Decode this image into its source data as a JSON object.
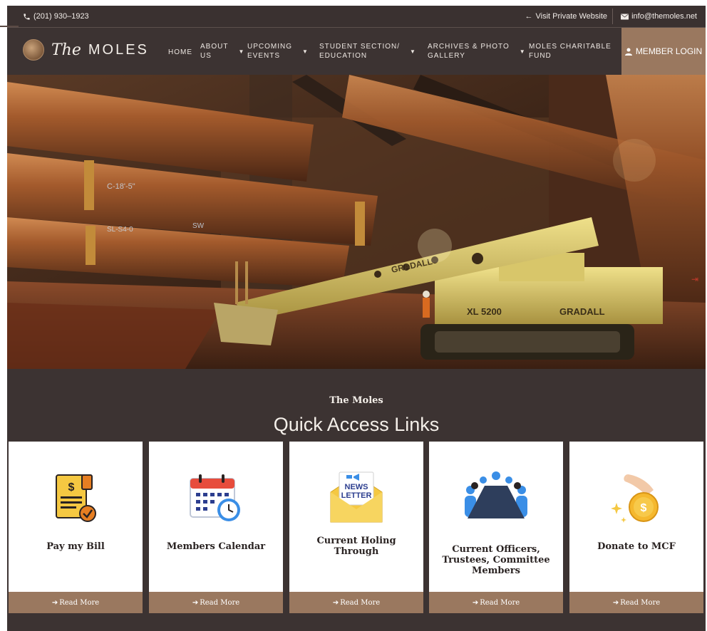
{
  "topbar": {
    "phone": "(201) 930–1923",
    "visit_link": "Visit Private Website",
    "email": "info@themoles.net"
  },
  "logo": {
    "the": "The",
    "moles": "MOLES"
  },
  "nav": {
    "items": [
      {
        "line1": "HOME",
        "line2": "",
        "has_dropdown": false
      },
      {
        "line1": "ABOUT",
        "line2": "US",
        "has_dropdown": true
      },
      {
        "line1": "UPCOMING",
        "line2": "EVENTS",
        "has_dropdown": true
      },
      {
        "line1": "STUDENT SECTION/",
        "line2": "EDUCATION",
        "has_dropdown": true
      },
      {
        "line1": "ARCHIVES & PHOTO",
        "line2": "GALLERY",
        "has_dropdown": true
      },
      {
        "line1": "MOLES CHARITABLE",
        "line2": "FUND",
        "has_dropdown": true
      }
    ],
    "login_label": "MEMBER LOGIN"
  },
  "hero": {
    "crane_text_1": "GRADALL",
    "crane_text_2": "XL 5200",
    "crane_text_3": "GRADALL",
    "pipe_marks": [
      "C-18'-5\"",
      "SW",
      "SL-S4-0"
    ]
  },
  "quick_access": {
    "subtitle": "The Moles",
    "title": "Quick Access Links",
    "cards": [
      {
        "label": "Pay my Bill",
        "icon": "bill-icon",
        "more": "Read More"
      },
      {
        "label": "Members Calendar",
        "icon": "calendar-icon",
        "more": "Read More"
      },
      {
        "label": "Current Holing Through",
        "icon": "newsletter-icon",
        "icon_text_1": "NEWS",
        "icon_text_2": "LETTER",
        "more": "Read More"
      },
      {
        "label": "Current Officers, Trustees, Committee Members",
        "icon": "meeting-icon",
        "more": "Read More"
      },
      {
        "label": "Donate to MCF",
        "icon": "donate-icon",
        "more": "Read More"
      }
    ]
  },
  "colors": {
    "background": "#3c3332",
    "accent": "#9a785f",
    "card": "#ffffff"
  }
}
